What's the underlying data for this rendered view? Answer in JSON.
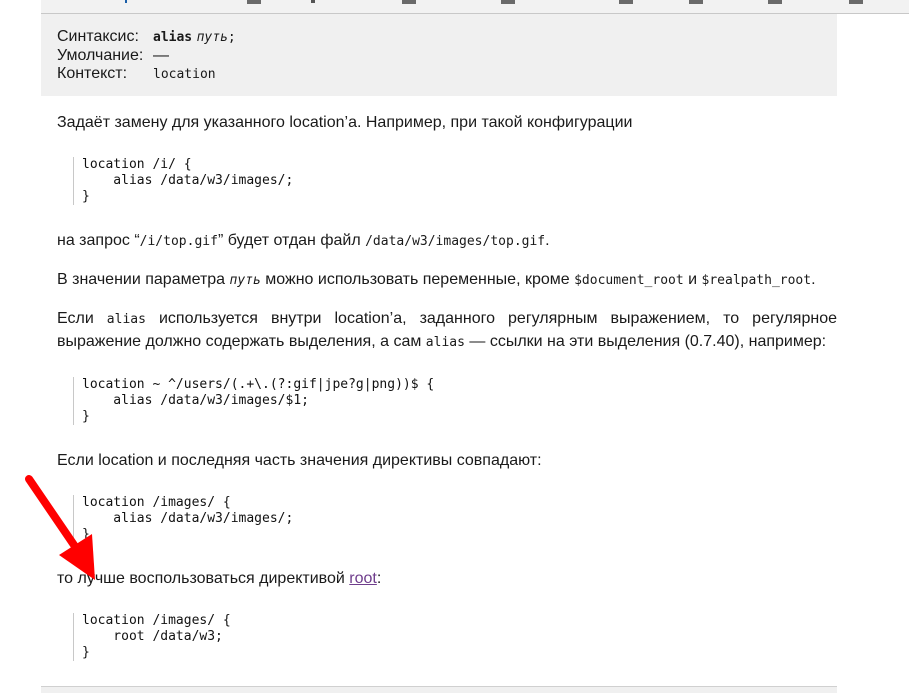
{
  "syntax": {
    "syntax_label": "Синтаксис:",
    "syntax_keyword": "alias",
    "syntax_param": "путь",
    "syntax_end": ";",
    "default_label": "Умолчание:",
    "default_value": "—",
    "context_label": "Контекст:",
    "context_value": "location"
  },
  "p1": {
    "text": "Задаёт замену для указанного location’а. Например, при такой конфигурации"
  },
  "code1": "location /i/ {\n    alias /data/w3/images/;\n}",
  "p2": {
    "t1": "на запрос “",
    "c1": "/i/top.gif",
    "t2": "” будет отдан файл ",
    "c2": "/data/w3/images/top.gif",
    "t3": "."
  },
  "p3": {
    "t1": "В значении параметра ",
    "c1": "путь",
    "t2": " можно использовать переменные, кроме ",
    "c2": "$document_root",
    "t3": " и ",
    "c3": "$realpath_root",
    "t4": "."
  },
  "p4": {
    "t1": "Если ",
    "c1": "alias",
    "t2": " используется внутри location’а, заданного регулярным выражением, то регулярное выражение должно содержать выделения, а сам ",
    "c2": "alias",
    "t3": " — ссылки на эти выделения (0.7.40), например:"
  },
  "code2": "location ~ ^/users/(.+\\.(?:gif|jpe?g|png))$ {\n    alias /data/w3/images/$1;\n}",
  "p5": {
    "text": "Если location и последняя часть значения директивы совпадают:"
  },
  "code3": "location /images/ {\n    alias /data/w3/images/;\n}",
  "p6": {
    "t1": "то лучше воспользоваться директивой ",
    "link": "root",
    "t2": ":"
  },
  "code4": "location /images/ {\n    root /data/w3;\n}",
  "annotation": {
    "arrow_color": "#ff0000"
  }
}
